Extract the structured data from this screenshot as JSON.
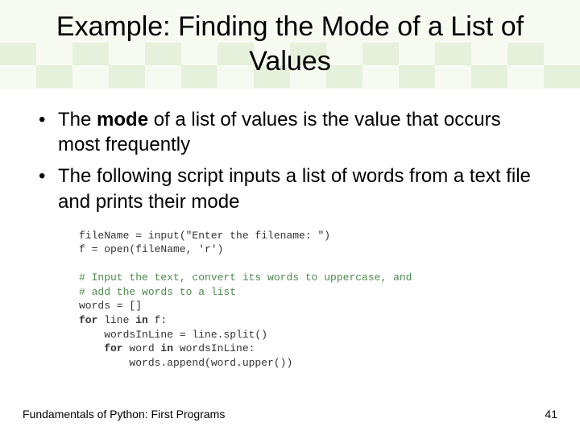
{
  "title": "Example: Finding the Mode of a List of Values",
  "bullets": [
    {
      "pre": "The ",
      "bold": "mode",
      "post": " of a list of values is the value that occurs most frequently"
    },
    {
      "pre": "The following script inputs a list of words from a text file and prints their mode",
      "bold": "",
      "post": ""
    }
  ],
  "code": {
    "l1": "fileName = input(\"Enter the filename: \")",
    "l2": "f = open(fileName, 'r')",
    "l3": "",
    "l4": "# Input the text, convert its words to uppercase, and",
    "l5": "# add the words to a list",
    "l6": "words = []",
    "l7a": "for",
    "l7b": " line ",
    "l7c": "in",
    "l7d": " f:",
    "l8": "    wordsInLine = line.split()",
    "l9a": "    for",
    "l9b": " word ",
    "l9c": "in",
    "l9d": " wordsInLine:",
    "l10": "        words.append(word.upper())"
  },
  "footer": {
    "left": "Fundamentals of Python: First Programs",
    "page": "41"
  }
}
